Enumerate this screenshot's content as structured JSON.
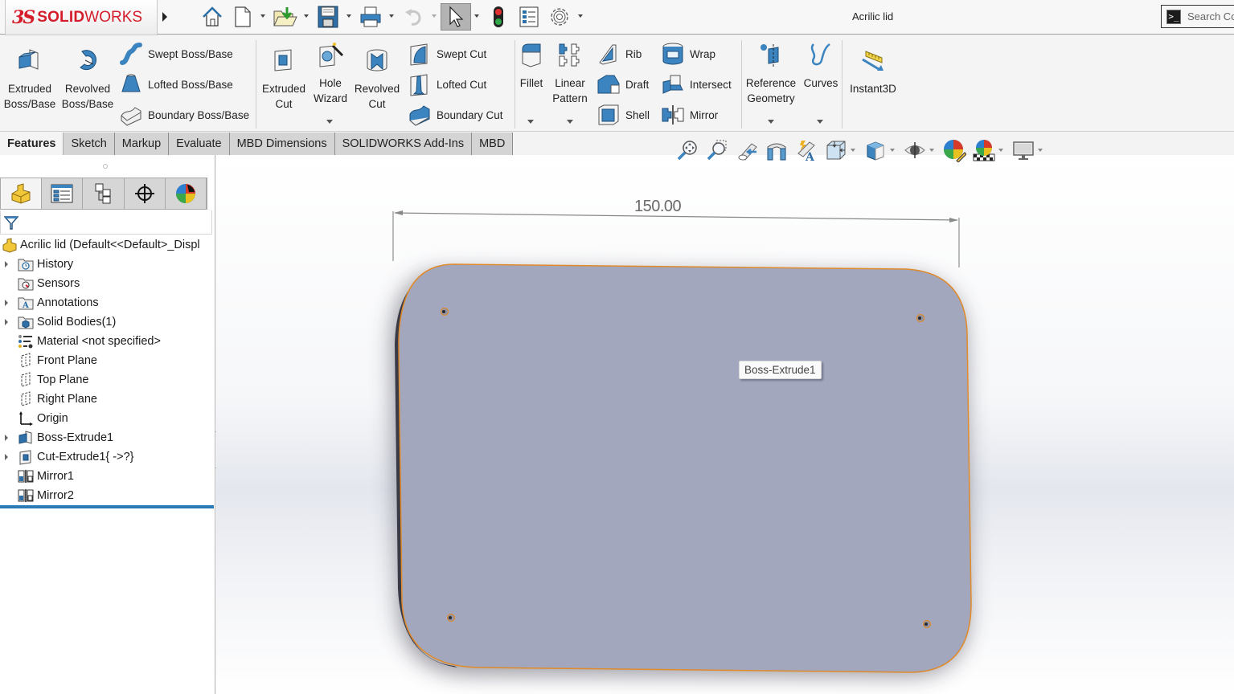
{
  "app": {
    "brand_prefix": "3S",
    "brand_bold": "SOLID",
    "brand_light": "WORKS",
    "document_title": "Acrilic lid",
    "search_placeholder": "Search Co"
  },
  "quick_access": [
    {
      "name": "home-icon"
    },
    {
      "name": "new-document-icon"
    },
    {
      "name": "open-icon"
    },
    {
      "name": "save-icon"
    },
    {
      "name": "print-icon"
    },
    {
      "name": "undo-icon"
    },
    {
      "name": "select-icon"
    },
    {
      "name": "rebuild-icon"
    },
    {
      "name": "file-properties-icon"
    },
    {
      "name": "options-icon"
    }
  ],
  "ribbon": {
    "extruded_boss": "Extruded\nBoss/Base",
    "extruded_boss_l1": "Extruded",
    "extruded_boss_l2": "Boss/Base",
    "revolved_boss_l1": "Revolved",
    "revolved_boss_l2": "Boss/Base",
    "swept_boss": "Swept Boss/Base",
    "lofted_boss": "Lofted Boss/Base",
    "boundary_boss": "Boundary Boss/Base",
    "extruded_cut_l1": "Extruded",
    "extruded_cut_l2": "Cut",
    "hole_wizard_l1": "Hole",
    "hole_wizard_l2": "Wizard",
    "revolved_cut_l1": "Revolved",
    "revolved_cut_l2": "Cut",
    "swept_cut": "Swept Cut",
    "lofted_cut": "Lofted Cut",
    "boundary_cut": "Boundary Cut",
    "fillet": "Fillet",
    "linear_pattern_l1": "Linear",
    "linear_pattern_l2": "Pattern",
    "rib": "Rib",
    "draft": "Draft",
    "shell": "Shell",
    "wrap": "Wrap",
    "intersect": "Intersect",
    "mirror": "Mirror",
    "reference_geometry_l1": "Reference",
    "reference_geometry_l2": "Geometry",
    "curves": "Curves",
    "instant3d": "Instant3D"
  },
  "tabs": [
    {
      "label": "Features",
      "active": true
    },
    {
      "label": "Sketch",
      "active": false
    },
    {
      "label": "Markup",
      "active": false
    },
    {
      "label": "Evaluate",
      "active": false
    },
    {
      "label": "MBD Dimensions",
      "active": false
    },
    {
      "label": "SOLIDWORKS Add-Ins",
      "active": false
    },
    {
      "label": "MBD",
      "active": false
    }
  ],
  "view_toolbar": [
    "zoom-to-fit-icon",
    "zoom-to-area-icon",
    "previous-view-icon",
    "section-view-icon",
    "dynamic-annotation-views-icon",
    "view-orientation-icon",
    "display-style-icon",
    "hide-show-items-icon",
    "edit-appearance-icon",
    "apply-scene-icon",
    "view-settings-icon"
  ],
  "feature_tree": {
    "root": "Acrilic lid  (Default<<Default>_Displ",
    "items": [
      {
        "label": "History",
        "expandable": true,
        "icon": "history-folder-icon"
      },
      {
        "label": "Sensors",
        "expandable": false,
        "icon": "sensors-folder-icon"
      },
      {
        "label": "Annotations",
        "expandable": true,
        "icon": "annotations-folder-icon"
      },
      {
        "label": "Solid Bodies(1)",
        "expandable": true,
        "icon": "solid-bodies-folder-icon"
      },
      {
        "label": "Material <not specified>",
        "expandable": false,
        "icon": "material-icon"
      },
      {
        "label": "Front Plane",
        "expandable": false,
        "icon": "plane-icon"
      },
      {
        "label": "Top Plane",
        "expandable": false,
        "icon": "plane-icon"
      },
      {
        "label": "Right Plane",
        "expandable": false,
        "icon": "plane-icon"
      },
      {
        "label": "Origin",
        "expandable": false,
        "icon": "origin-icon"
      },
      {
        "label": "Boss-Extrude1",
        "expandable": true,
        "icon": "boss-extrude-icon"
      },
      {
        "label": "Cut-Extrude1{ ->?}",
        "expandable": true,
        "icon": "cut-extrude-icon"
      },
      {
        "label": "Mirror1",
        "expandable": false,
        "icon": "mirror-icon"
      },
      {
        "label": "Mirror2",
        "expandable": false,
        "icon": "mirror-icon"
      }
    ]
  },
  "graphics": {
    "dimension_value": "150.00",
    "tooltip": "Boss-Extrude1",
    "part_color": "#a2a7be",
    "edge_highlight_color": "#e08a2a"
  }
}
